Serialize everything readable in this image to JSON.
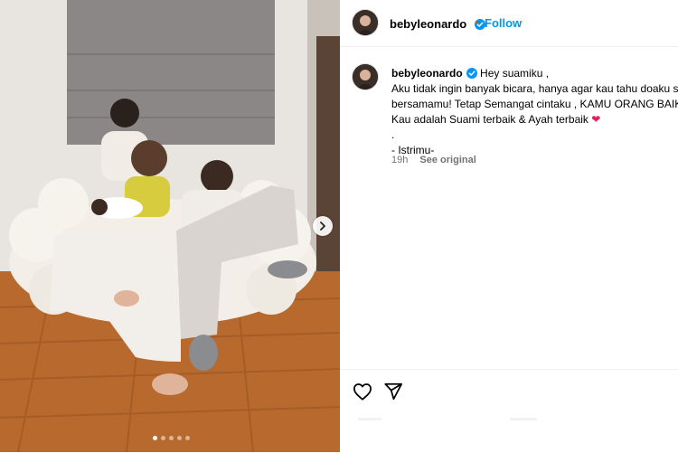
{
  "post": {
    "username": "bebyleonardo",
    "follow_label": "Follow",
    "separator": "•",
    "caption_lines": [
      "Hey suamiku ,",
      "Aku tidak ingin banyak bicara, hanya agar kau tahu doaku se",
      "bersamamu! Tetap Semangat cintaku , KAMU ORANG BAIK !",
      "Kau adalah Suami terbaik & Ayah terbaik",
      ".",
      "- Istrimu-"
    ],
    "heart_emoji": "❤",
    "time_ago": "19h",
    "see_original": "See original"
  },
  "carousel": {
    "slide_count": 5,
    "active_index": 0
  },
  "icons": {
    "verified": "verified-badge-icon",
    "next": "chevron-right-icon",
    "like": "heart-icon",
    "share": "send-icon"
  },
  "colors": {
    "accent": "#0095f6",
    "verified": "#0095f6",
    "heart_emoji": "#e0245e"
  }
}
